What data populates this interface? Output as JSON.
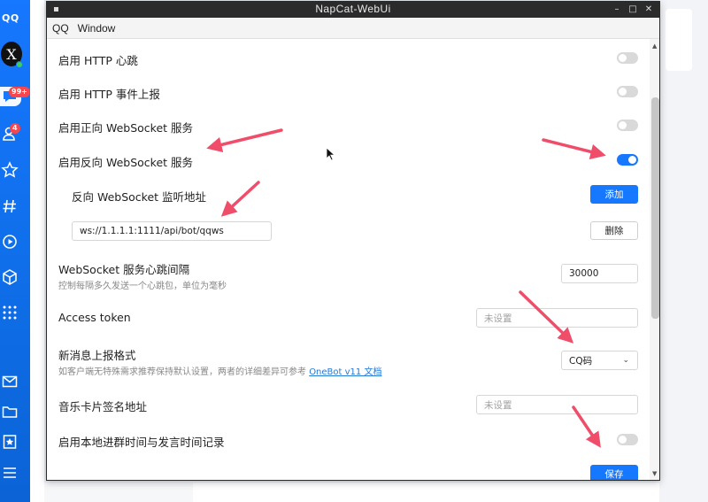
{
  "window": {
    "title": "NapCat-WebUi",
    "menu": [
      "QQ",
      "Window"
    ],
    "controls": [
      "–",
      "□",
      "✕"
    ]
  },
  "background_app": {
    "logo": "QQ",
    "avatar_letter": "X",
    "badges": {
      "messages": "99+",
      "contacts": "4"
    },
    "accent_color": "#1677ff",
    "sidebar_icons": [
      "message-icon",
      "contacts-icon",
      "star-icon",
      "hashtag-icon",
      "video-icon",
      "cube-icon",
      "apps-grid-icon",
      "mail-icon",
      "folder-icon",
      "bookmark-icon",
      "menu-icon"
    ]
  },
  "settings": {
    "http_heartbeat": {
      "label": "启用 HTTP 心跳",
      "enabled": false
    },
    "http_event_report": {
      "label": "启用 HTTP 事件上报",
      "enabled": false
    },
    "forward_ws": {
      "label": "启用正向 WebSocket 服务",
      "enabled": false
    },
    "reverse_ws": {
      "label": "启用反向 WebSocket 服务",
      "enabled": true
    },
    "reverse_ws_addr": {
      "label": "反向 WebSocket 监听地址",
      "add_button": "添加",
      "entries": [
        {
          "value": "ws://1.1.1.1:1111/api/bot/qqws",
          "delete_button": "删除"
        }
      ]
    },
    "ws_heartbeat_interval": {
      "label": "WebSocket 服务心跳间隔",
      "desc": "控制每隔多久发送一个心跳包，单位为毫秒",
      "value": "30000"
    },
    "access_token": {
      "label": "Access token",
      "placeholder": "未设置"
    },
    "message_format": {
      "label": "新消息上报格式",
      "desc": "如客户端无特殊需求推荐保持默认设置，两者的详细差异可参考",
      "link": "OneBot v11 文档",
      "value": "CQ码"
    },
    "music_sign_url": {
      "label": "音乐卡片签名地址",
      "placeholder": "未设置"
    },
    "local_record": {
      "label": "启用本地进群时间与发言时间记录",
      "enabled": false
    },
    "save_button": "保存"
  },
  "annotation_color": "#f04d6a"
}
